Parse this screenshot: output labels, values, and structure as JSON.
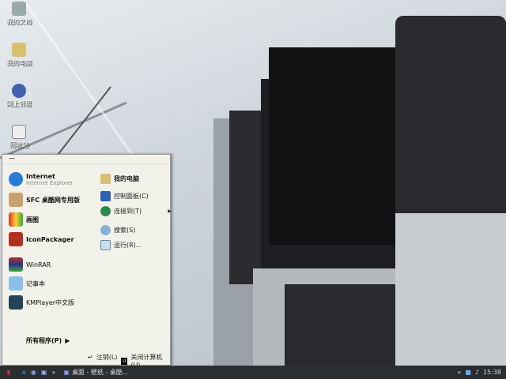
{
  "desktop_icons": [
    {
      "label": "我的文档",
      "icon": "documents-icon"
    },
    {
      "label": "我的电脑",
      "icon": "computer-icon"
    },
    {
      "label": "网上邻居",
      "icon": "network-icon"
    },
    {
      "label": "回收站",
      "icon": "recycle-bin-icon"
    }
  ],
  "start_menu": {
    "user": "—",
    "left_items": [
      {
        "label": "Internet",
        "sub": "Internet Explorer",
        "icon": "ie-icon"
      },
      {
        "label": "SFC 桌酷网专用版",
        "icon": "sfc-icon"
      },
      {
        "label": "画图",
        "icon": "paint-icon"
      },
      {
        "label": "IconPackager",
        "icon": "iconpackager-icon"
      },
      {
        "label": "WinRAR",
        "icon": "winrar-icon"
      },
      {
        "label": "记事本",
        "icon": "notepad-icon"
      },
      {
        "label": "KMPlayer中文版",
        "icon": "kmplayer-icon"
      }
    ],
    "all_programs": "所有程序(P)",
    "right_items": [
      {
        "label": "我的电脑",
        "icon": "computer-icon"
      },
      {
        "label": "控制面板(C)",
        "icon": "control-panel-icon"
      },
      {
        "label": "连接到(T)",
        "icon": "connect-icon",
        "submenu": true
      },
      {
        "label": "搜索(S)",
        "icon": "search-icon"
      },
      {
        "label": "运行(R)...",
        "icon": "run-icon"
      }
    ],
    "logoff": "注销(L)",
    "shutdown": "关闭计算机(U)"
  },
  "taskbar": {
    "task": "桌面 - 壁纸 - 桌酷...",
    "clock": "15:38"
  },
  "colors": {
    "taskbar": "#2a2e30",
    "menu_bg": "#f2f2ea"
  }
}
